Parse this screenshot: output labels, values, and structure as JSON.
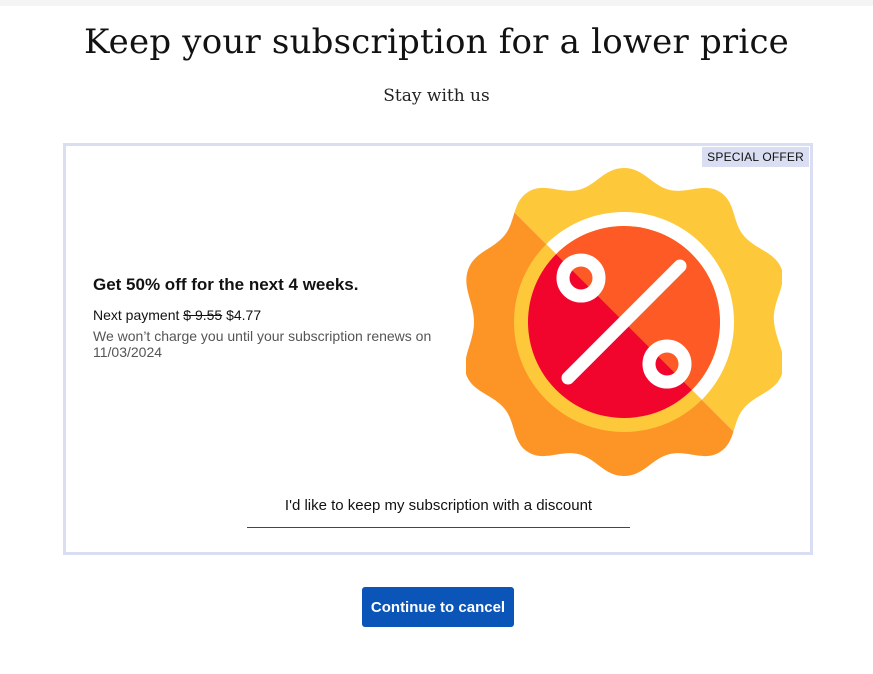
{
  "header": {
    "title": "Keep your subscription for a lower price",
    "subtitle": "Stay with us"
  },
  "offer": {
    "badge": "SPECIAL OFFER",
    "title": "Get 50% off for the next 4 weeks.",
    "next_payment_label": "Next payment",
    "old_price": "$ 9.55",
    "new_price": "$4.77",
    "renew_note": "We won’t charge you until your subscription renews on 11/03/2024",
    "keep_link": "I'd like to keep my subscription with a discount",
    "graphic_icon": "discount-percent-badge-icon"
  },
  "actions": {
    "continue_label": "Continue to cancel"
  },
  "colors": {
    "accent": "#0b55b8",
    "card_border": "#d9def2",
    "badge_yellow": "#fdc93a",
    "badge_orange": "#fd9426",
    "badge_red": "#f2052c"
  }
}
